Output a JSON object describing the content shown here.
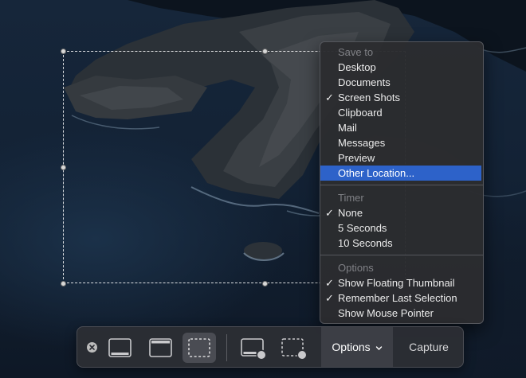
{
  "menu": {
    "sections": [
      {
        "header": "Save to",
        "items": [
          {
            "label": "Desktop",
            "checked": false
          },
          {
            "label": "Documents",
            "checked": false
          },
          {
            "label": "Screen Shots",
            "checked": true
          },
          {
            "label": "Clipboard",
            "checked": false
          },
          {
            "label": "Mail",
            "checked": false
          },
          {
            "label": "Messages",
            "checked": false
          },
          {
            "label": "Preview",
            "checked": false
          },
          {
            "label": "Other Location...",
            "checked": false,
            "highlighted": true
          }
        ]
      },
      {
        "header": "Timer",
        "items": [
          {
            "label": "None",
            "checked": true
          },
          {
            "label": "5 Seconds",
            "checked": false
          },
          {
            "label": "10 Seconds",
            "checked": false
          }
        ]
      },
      {
        "header": "Options",
        "items": [
          {
            "label": "Show Floating Thumbnail",
            "checked": true
          },
          {
            "label": "Remember Last Selection",
            "checked": true
          },
          {
            "label": "Show Mouse Pointer",
            "checked": false
          }
        ]
      }
    ],
    "check_glyph": "✓",
    "highlight_color": "#2d62c9"
  },
  "toolbar": {
    "close_icon": "close-icon",
    "modes": [
      {
        "icon": "capture-entire-screen-icon",
        "active": false
      },
      {
        "icon": "capture-window-icon",
        "active": false
      },
      {
        "icon": "capture-selection-icon",
        "active": true
      },
      {
        "icon": "record-entire-screen-icon",
        "active": false
      },
      {
        "icon": "record-selection-icon",
        "active": false
      }
    ],
    "options_label": "Options",
    "capture_label": "Capture"
  }
}
